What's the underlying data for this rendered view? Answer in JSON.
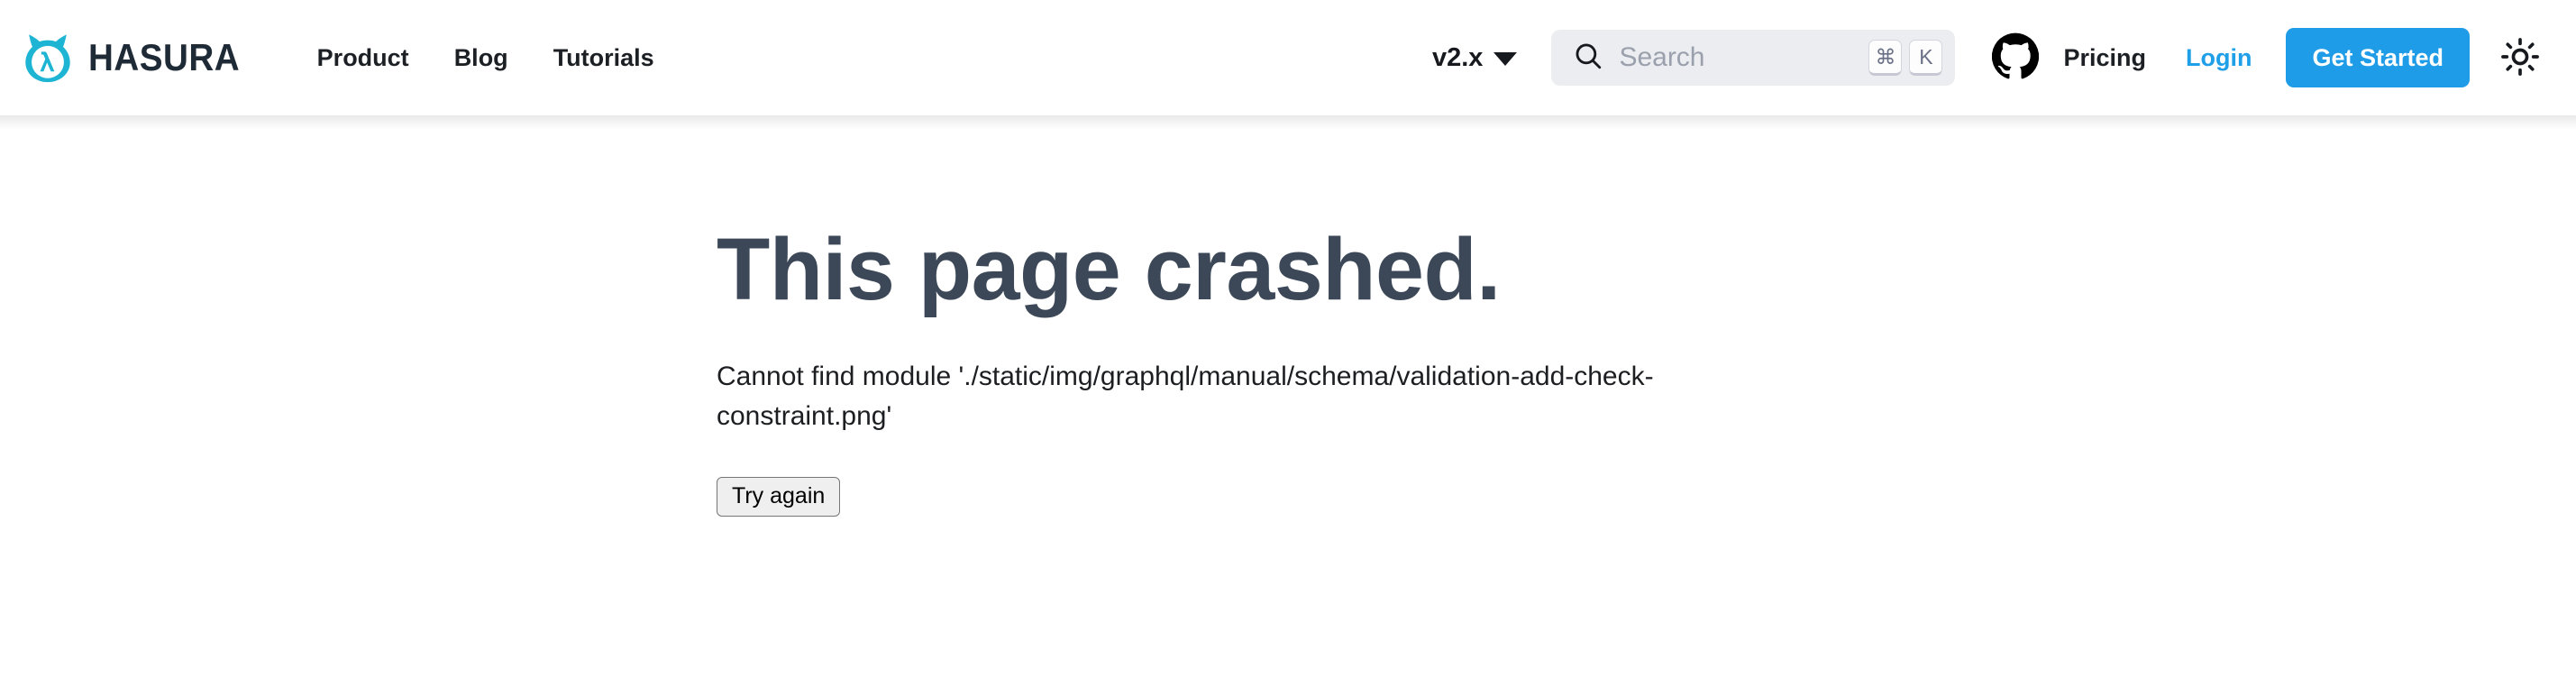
{
  "navbar": {
    "brand": {
      "wordmark": "HASURA",
      "logo_icon": "hasura-lambda-logo",
      "logo_color": "#1eb4d4"
    },
    "links": [
      {
        "label": "Product"
      },
      {
        "label": "Blog"
      },
      {
        "label": "Tutorials"
      }
    ],
    "version": {
      "label": "v2.x",
      "caret_icon": "chevron-down-icon"
    },
    "search": {
      "placeholder": "Search",
      "icon": "search-icon",
      "shortcut_keys": [
        "⌘",
        "K"
      ]
    },
    "github": {
      "icon": "github-icon"
    },
    "right_links": [
      {
        "label": "Pricing",
        "style": "dark"
      },
      {
        "label": "Login",
        "style": "accent"
      }
    ],
    "cta": {
      "label": "Get Started",
      "color": "#1f9ce8"
    },
    "theme_toggle": {
      "icon": "sun-icon",
      "mode": "light"
    }
  },
  "main": {
    "error_title": "This page crashed.",
    "error_message": "Cannot find module './static/img/graphql/manual/schema/validation-add-check-constraint.png'",
    "retry_label": "Try again"
  }
}
